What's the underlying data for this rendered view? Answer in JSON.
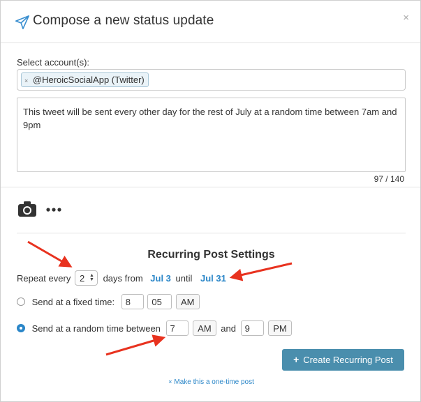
{
  "dialog": {
    "title": "Compose a new status update",
    "close_symbol": "×"
  },
  "account": {
    "label": "Select account(s):",
    "selected_tag": "@HeroicSocialApp (Twitter)",
    "tag_remove_symbol": "×"
  },
  "message": {
    "text": "This tweet will be sent every other day for the rest of July at a random time between 7am and 9pm",
    "char_count": "97 / 140"
  },
  "recurring": {
    "title": "Recurring Post Settings",
    "repeat_label": "Repeat every",
    "repeat_value": "2",
    "days_from_label": "days from",
    "start_date": "Jul 3",
    "until_label": "until",
    "end_date": "Jul 31",
    "fixed_time": {
      "label": "Send at a fixed time:",
      "hour": "8",
      "minute": "05",
      "ampm": "AM",
      "selected": false
    },
    "random_time": {
      "label": "Send at a random time between",
      "from_hour": "7",
      "from_ampm": "AM",
      "and_label": "and",
      "to_hour": "9",
      "to_ampm": "PM",
      "selected": true
    }
  },
  "actions": {
    "create_button": "Create Recurring Post",
    "create_button_icon": "+",
    "one_time_link": "Make this a one-time post",
    "one_time_link_icon": "×"
  },
  "colors": {
    "accent_link": "#2a86c8",
    "button_bg": "#4a8ead",
    "annotation_arrow": "#e8321f"
  },
  "icons": [
    "paper-plane-icon",
    "close-icon",
    "camera-icon",
    "more-icon"
  ]
}
